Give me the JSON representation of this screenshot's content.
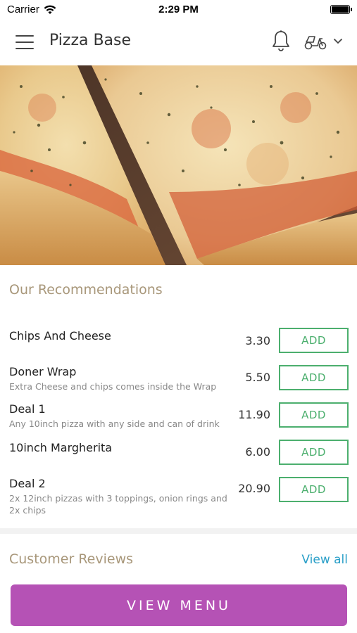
{
  "status_bar": {
    "carrier": "Carrier",
    "time": "2:29 PM"
  },
  "header": {
    "title": "Pizza Base",
    "icons": [
      "menu-icon",
      "bell-icon",
      "scooter-icon",
      "chevron-down-icon"
    ]
  },
  "hero": {
    "image": "pizza-slices-photo"
  },
  "recommendations": {
    "title": "Our Recommendations",
    "add_label": "ADD",
    "items": [
      {
        "name": "Chips And Cheese",
        "description": "",
        "price": "3.30"
      },
      {
        "name": "Doner Wrap",
        "description": "Extra Cheese and chips comes inside the Wrap",
        "price": "5.50"
      },
      {
        "name": "Deal 1",
        "description": "Any 10inch pizza with any side and can of drink",
        "price": "11.90"
      },
      {
        "name": "10inch Margherita",
        "description": "",
        "price": "6.00"
      },
      {
        "name": "Deal 2",
        "description": "2x 12inch pizzas with 3 toppings, onion rings and 2x chips",
        "price": "20.90"
      }
    ]
  },
  "reviews": {
    "title": "Customer Reviews",
    "view_all": "View all"
  },
  "footer": {
    "view_menu": "VIEW MENU"
  },
  "colors": {
    "accent_gold": "#a8977a",
    "add_green": "#4caf6e",
    "link_blue": "#2a9fc8",
    "button_purple": "#b552b5"
  }
}
